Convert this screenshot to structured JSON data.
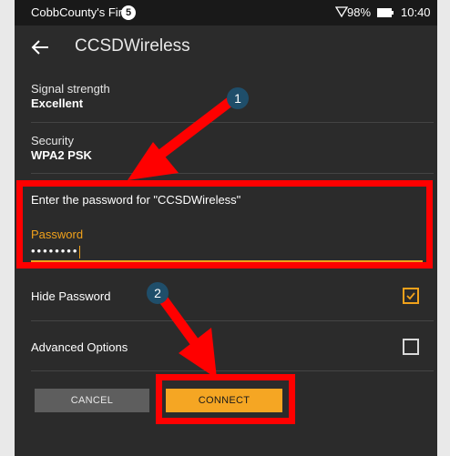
{
  "status_bar": {
    "carrier": "CobbCounty's Fire",
    "notification_count": "5",
    "battery_percent": "98%",
    "time": "10:40"
  },
  "app_bar": {
    "title": "CCSDWireless",
    "back_icon": "back-arrow-icon"
  },
  "network_info": {
    "signal_label": "Signal strength",
    "signal_value": "Excellent",
    "security_label": "Security",
    "security_value": "WPA2 PSK"
  },
  "password_section": {
    "prompt": "Enter the password for \"CCSDWireless\"",
    "label": "Password",
    "masked_value": "••••••••"
  },
  "options": {
    "hide_password_label": "Hide Password",
    "hide_password_checked": true,
    "advanced_label": "Advanced Options",
    "advanced_checked": false
  },
  "buttons": {
    "cancel": "CANCEL",
    "connect": "CONNECT"
  },
  "annotations": {
    "step1": "1",
    "step2": "2",
    "color": "#ff0000",
    "badge_color": "#1f4e6a"
  },
  "colors": {
    "accent": "#f0a11b",
    "connect_button": "#f5a623",
    "background": "#2b2b2b"
  }
}
